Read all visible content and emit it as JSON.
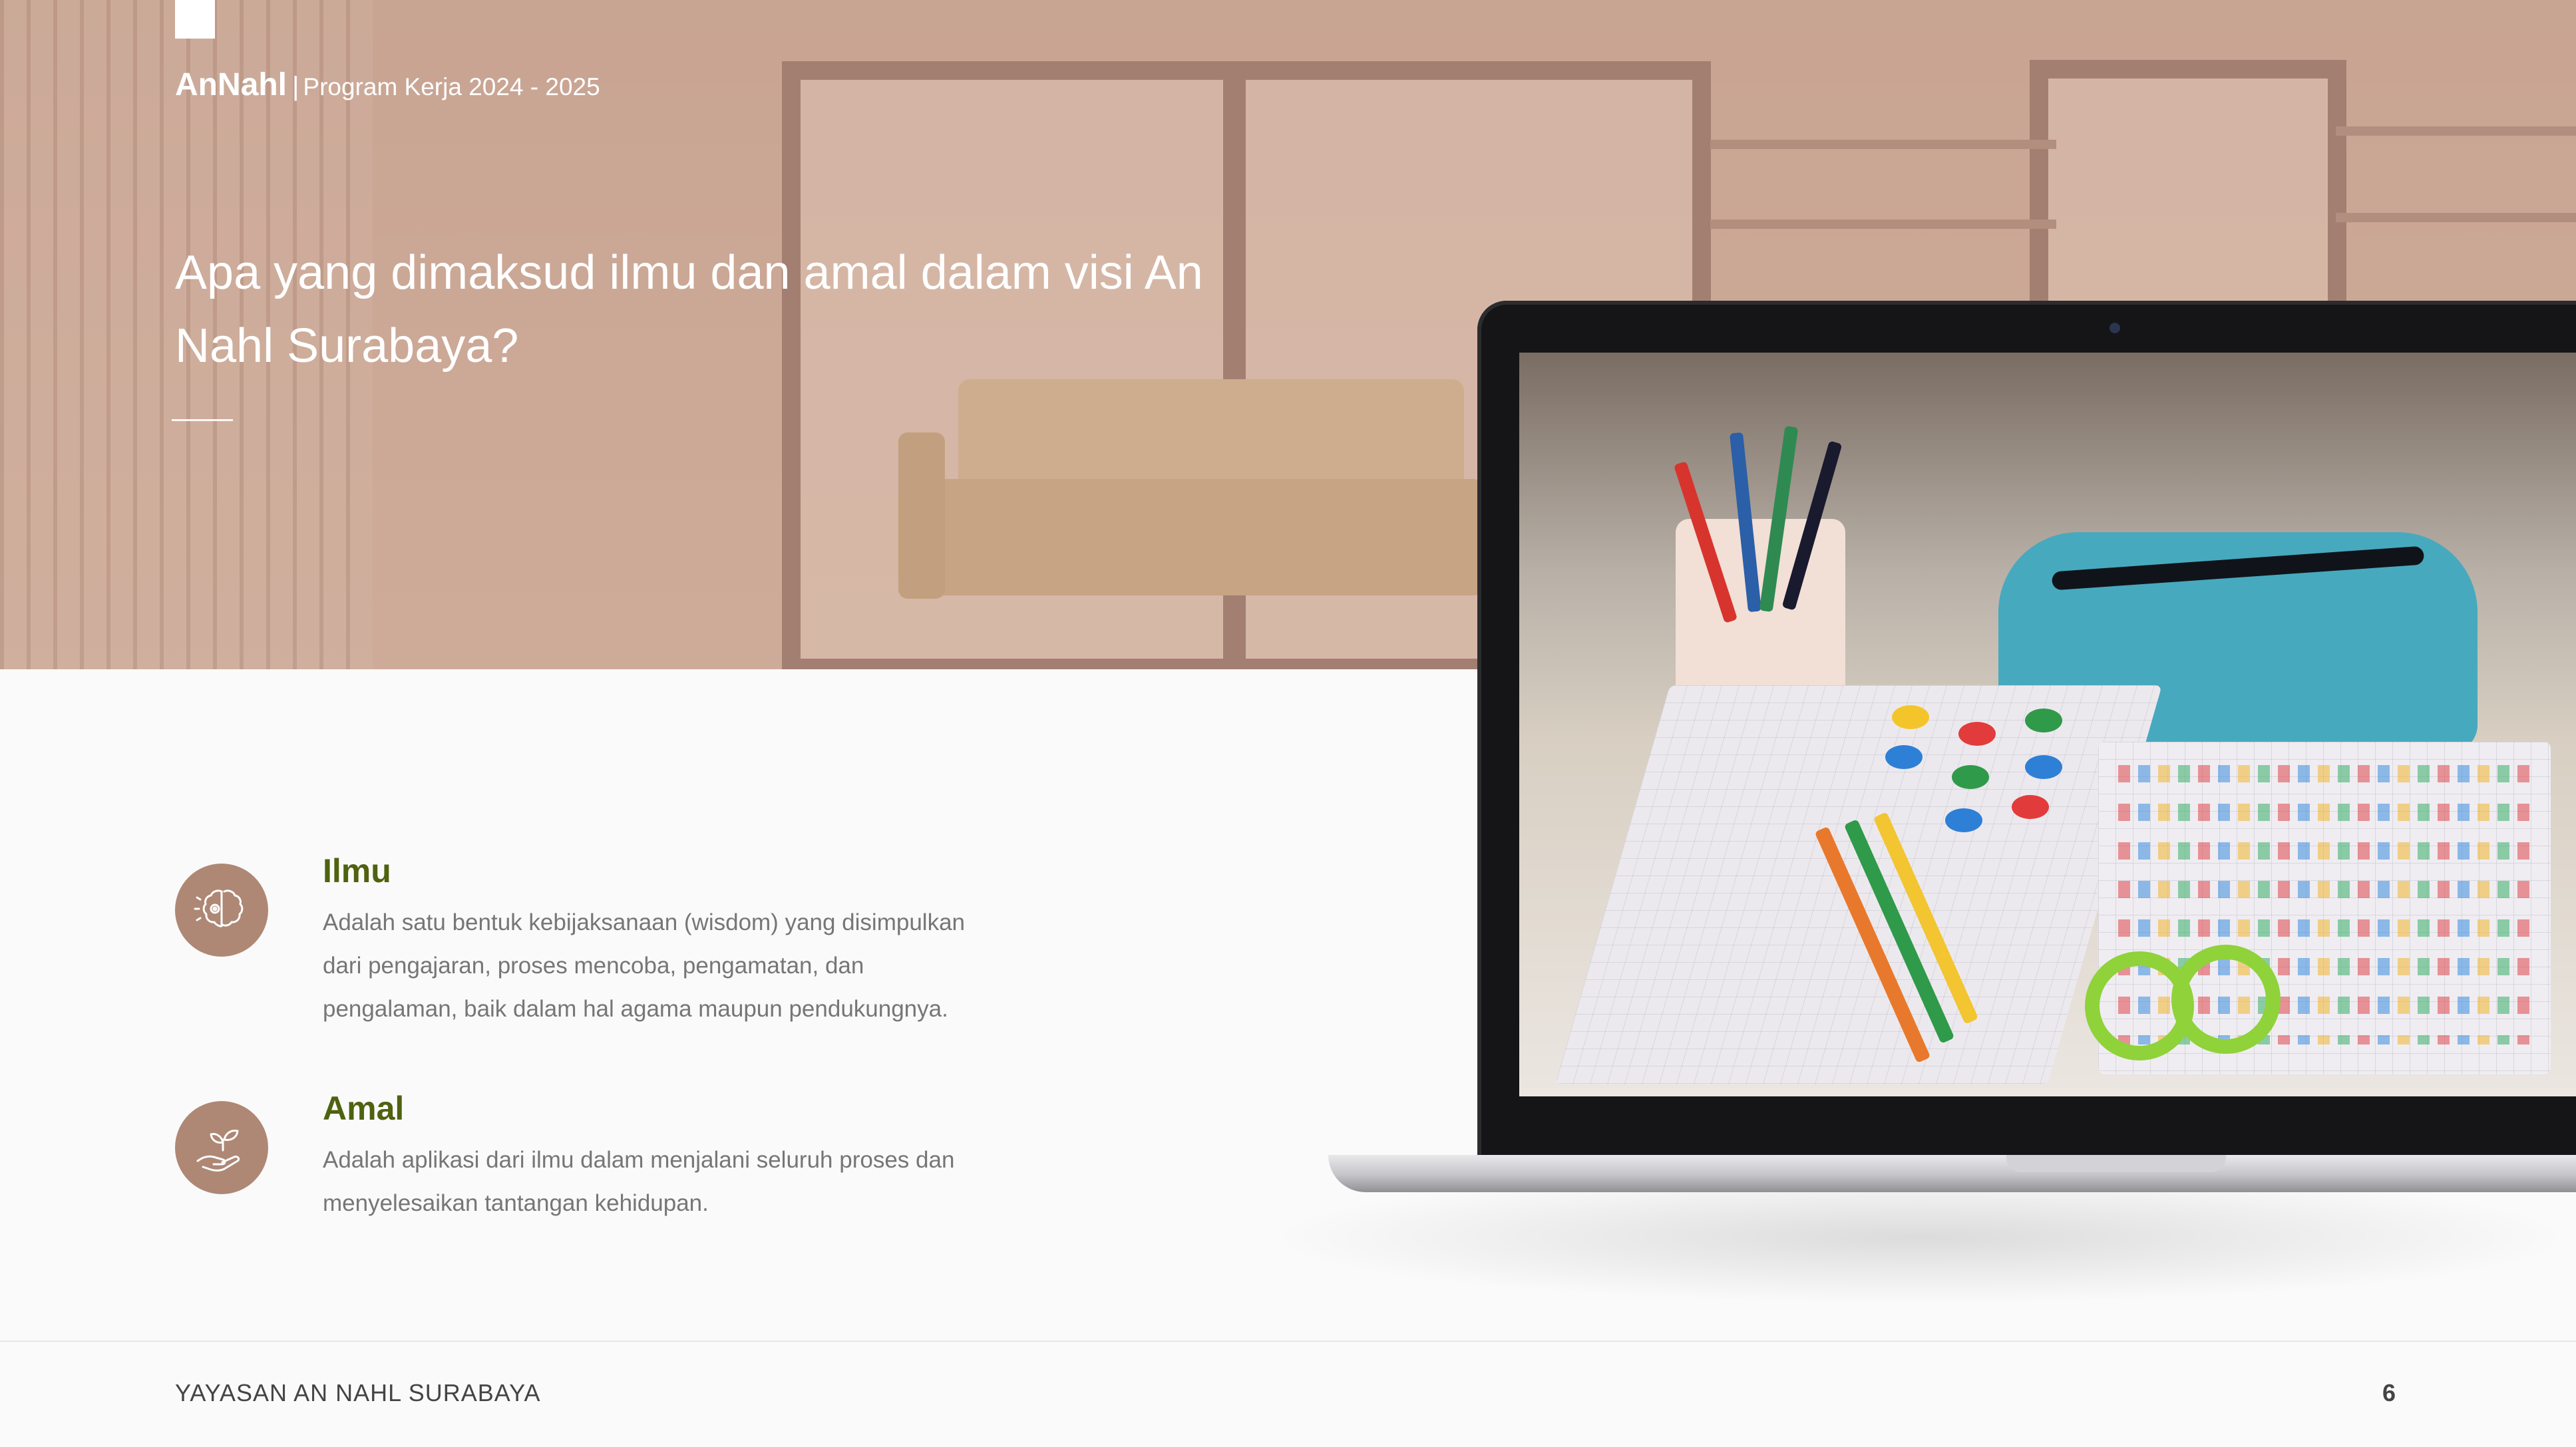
{
  "header": {
    "brand": "AnNahl",
    "separator": "|",
    "subtitle": "Program Kerja 2024 - 2025"
  },
  "hero": {
    "title": "Apa yang dimaksud ilmu dan amal dalam visi An Nahl Surabaya?"
  },
  "items": [
    {
      "icon": "brain-gear-icon",
      "title": "Ilmu",
      "description": "Adalah satu bentuk kebijaksanaan (wisdom) yang disimpulkan dari pengajaran, proses mencoba, pengamatan, dan pengalaman, baik dalam hal agama maupun pendukungnya."
    },
    {
      "icon": "hand-sprout-icon",
      "title": "Amal",
      "description": "Adalah aplikasi dari ilmu dalam menjalani seluruh proses dan menyelesaikan tantangan kehidupan."
    }
  ],
  "footer": {
    "organization": "YAYASAN AN NAHL SURABAYA",
    "page_number": "6"
  },
  "colors": {
    "hero_tint": "#c49682",
    "icon_circle": "#ae8875",
    "item_title": "#4e6210",
    "body_text": "#767676",
    "footer_text": "#444444"
  }
}
